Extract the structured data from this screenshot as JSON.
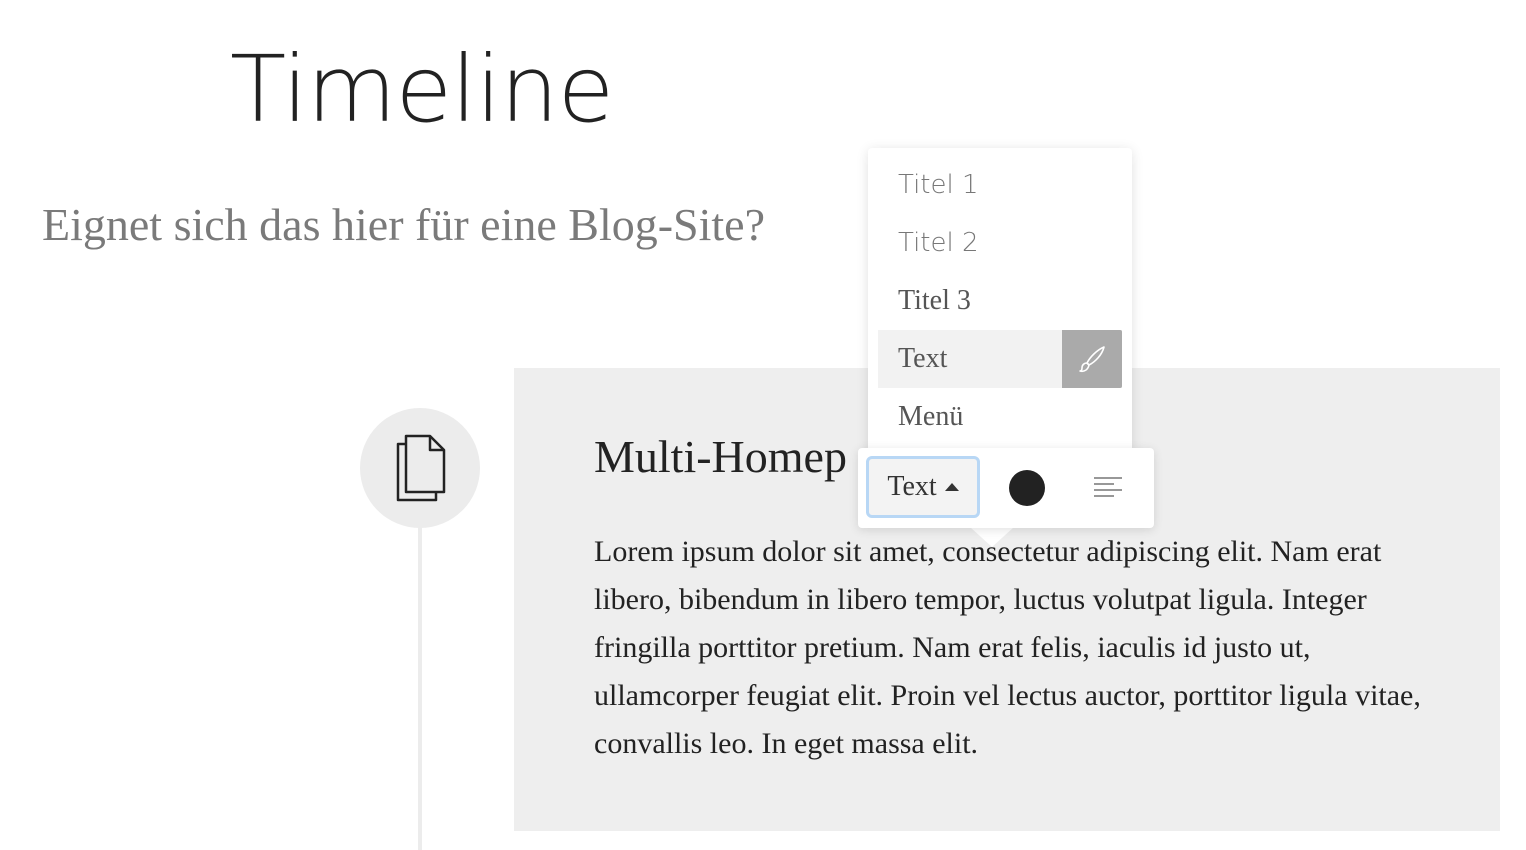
{
  "page": {
    "title": "Timeline",
    "subtitle": "Eignet sich das hier für eine Blog-Site?"
  },
  "timeline": {
    "icon": "documents-icon"
  },
  "card": {
    "title": "Multi-Homep",
    "body": "Lorem ipsum dolor sit amet, consectetur adipiscing elit. Nam erat libero, bibendum in libero tempor, luctus volutpat ligula. Integer fringilla porttitor pretium. Nam erat felis, iaculis id justo ut, ullamcorper feugiat elit. Proin vel lectus auctor, porttitor ligula vitae, convallis leo. In eget massa elit."
  },
  "style_menu": {
    "items": [
      {
        "label": "Titel 1"
      },
      {
        "label": "Titel 2"
      },
      {
        "label": "Titel 3"
      },
      {
        "label": "Text",
        "active": true,
        "icon": "brush-icon"
      },
      {
        "label": "Menü"
      }
    ]
  },
  "toolbar": {
    "style_label": "Text",
    "caret_icon": "caret-up-icon",
    "text_color": "#222222",
    "align_icon": "align-left-icon"
  },
  "colors": {
    "card_background": "#eeeeee",
    "active_item_background": "#f2f2f2",
    "brush_button": "#aaaaaa",
    "focus_border": "#b8d7f5"
  }
}
